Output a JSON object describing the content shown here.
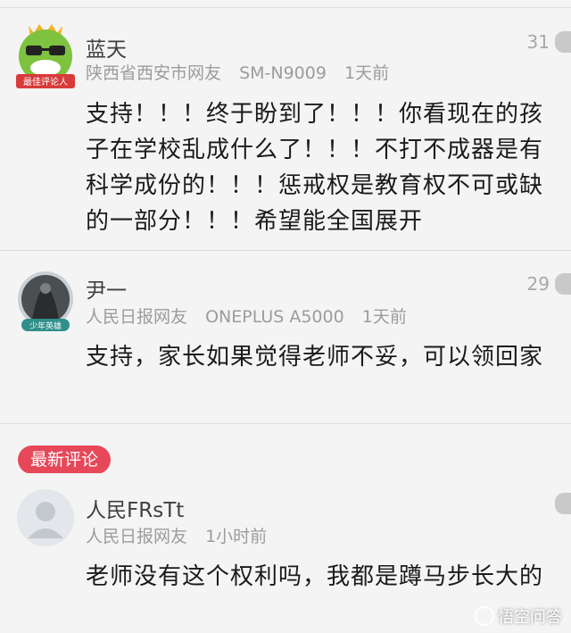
{
  "comments": [
    {
      "username": "蓝天",
      "avatar_badge": "最佳评论人",
      "location": "陕西省西安市网友",
      "device": "SM-N9009",
      "time": "1天前",
      "likes": "31",
      "content": "支持！！！终于盼到了！！！你看现在的孩子在学校乱成什么了！！！不打不成器是有科学成份的！！！惩戒权是教育权不可或缺的一部分！！！希望能全国展开"
    },
    {
      "username": "尹一",
      "avatar_badge": "少年英雄",
      "location": "人民日报网友",
      "device": "ONEPLUS A5000",
      "time": "1天前",
      "likes": "29",
      "content": "支持，家长如果觉得老师不妥，可以领回家"
    },
    {
      "username": "人民FRsTt",
      "location": "人民日报网友",
      "time": "1小时前",
      "content": "老师没有这个权利吗，我都是蹲马步长大的"
    }
  ],
  "section_label": "最新评论",
  "watermark": "悟空问答",
  "colors": {
    "accent": "#e6485a",
    "background": "#f4f4f4"
  }
}
